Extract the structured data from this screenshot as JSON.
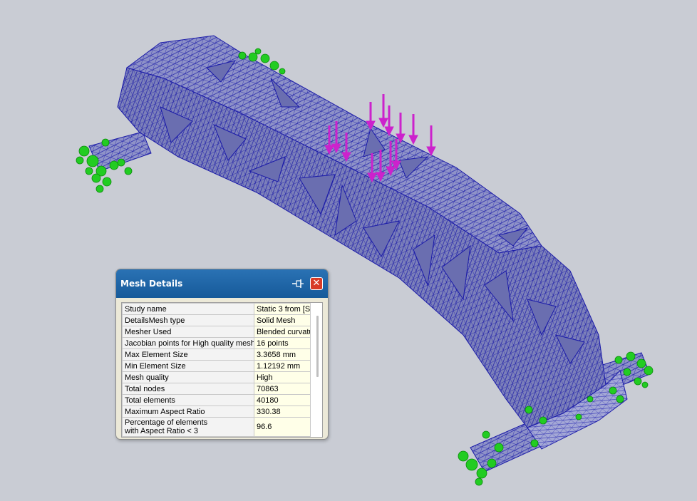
{
  "dialog": {
    "title": "Mesh Details",
    "pin_icon": "pin-icon",
    "close_icon": "close-icon",
    "close_glyph": "✕",
    "rows": [
      {
        "label": "Study name",
        "value": "Static 3 from [St"
      },
      {
        "label": "DetailsMesh type",
        "value": "Solid Mesh"
      },
      {
        "label": "Mesher Used",
        "value": "Blended curvatu"
      },
      {
        "label": "Jacobian points for High quality mesh",
        "value": "16 points"
      },
      {
        "label": "Max Element Size",
        "value": "3.3658 mm"
      },
      {
        "label": "Min Element Size",
        "value": "1.12192 mm"
      },
      {
        "label": "Mesh quality",
        "value": "High"
      },
      {
        "label": "Total nodes",
        "value": "70863"
      },
      {
        "label": "Total elements",
        "value": "40180"
      },
      {
        "label": "Maximum Aspect Ratio",
        "value": "330.38"
      },
      {
        "label": "Percentage of elements\nwith Aspect Ratio < 3",
        "value": "96.6"
      }
    ]
  },
  "colors": {
    "background": "#c9ccd4",
    "mesh_fill": "#8e92c8",
    "mesh_edge": "#1a1aa8",
    "load_arrow": "#cc22cc",
    "fixture": "#22cc22",
    "titlebar": "#1c64a4"
  }
}
